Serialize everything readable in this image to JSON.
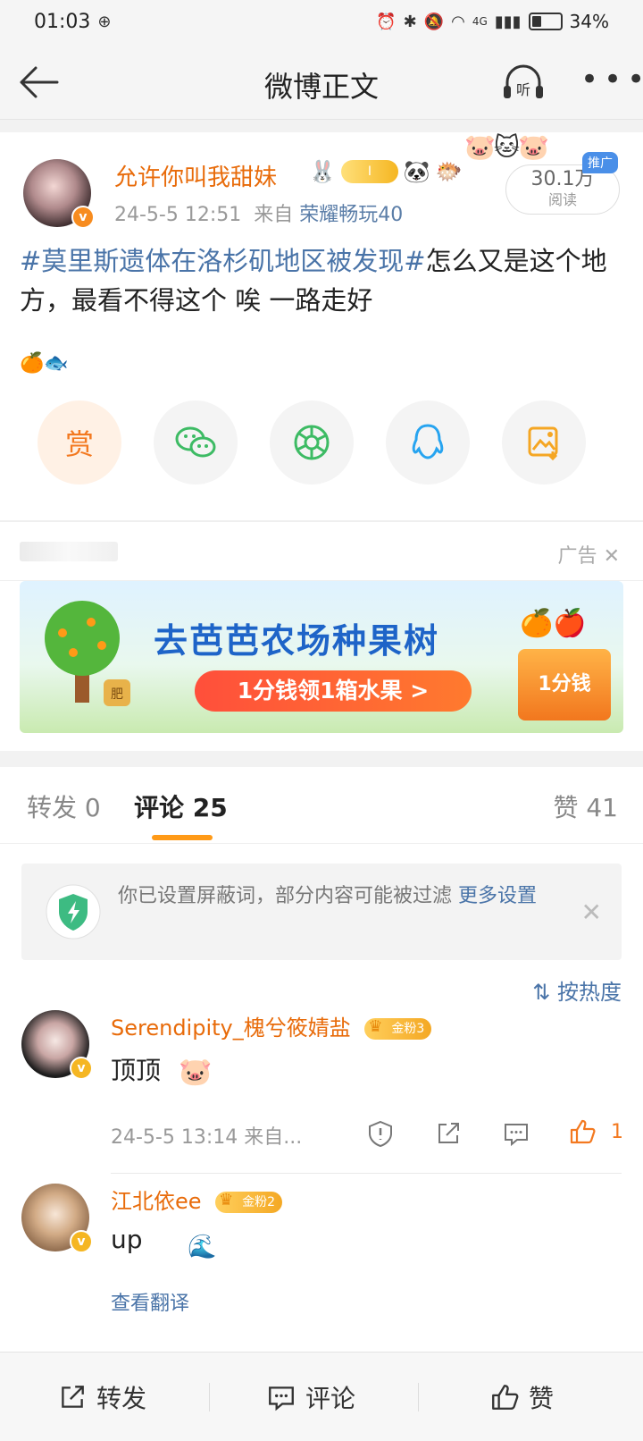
{
  "status_bar": {
    "time": "01:03",
    "battery": "34%",
    "network": "4G"
  },
  "nav": {
    "title": "微博正文",
    "listen_label": "听"
  },
  "post": {
    "username": "允许你叫我甜妹",
    "level_badge": "I",
    "timestamp": "24-5-5 12:51",
    "source_prefix": "来自",
    "source": "荣耀畅玩40",
    "reads": "30.1万",
    "reads_label": "阅读",
    "promo_label": "推广",
    "hashtag": "#莫里斯遗体在洛杉矶地区被发现#",
    "text": "怎么又是这个地方，最看不得这个 唉 一路走好",
    "emoji_line": "🍊🐟",
    "reward_label": "赏"
  },
  "ad": {
    "label": "广告",
    "headline": "去芭芭农场种果树",
    "cta": "1分钱领1箱水果 >",
    "box_label": "1分钱",
    "tree_tag": "肥"
  },
  "tabs": [
    {
      "label": "转发 0",
      "active": false
    },
    {
      "label": "评论 25",
      "active": true
    },
    {
      "label": "赞 41",
      "active": false
    }
  ],
  "notice": {
    "text": "你已设置屏蔽词，部分内容可能被过滤 ",
    "link": "更多设置"
  },
  "sort_label": "按热度",
  "comments": [
    {
      "name": "Serendipity_槐兮筱婧盐",
      "fan_badge": "金粉3",
      "text": "顶顶",
      "meta": "24-5-5 13:14  来自...",
      "likes": "1"
    },
    {
      "name": "江北依ee",
      "fan_badge": "金粉2",
      "text": "up",
      "translate": "查看翻译"
    }
  ],
  "bottom_bar": {
    "repost": "转发",
    "comment": "评论",
    "like": "赞"
  },
  "colors": {
    "accent_orange": "#e86b0a",
    "link_blue": "#4a74a8",
    "tab_indicator": "#ff9a17"
  }
}
